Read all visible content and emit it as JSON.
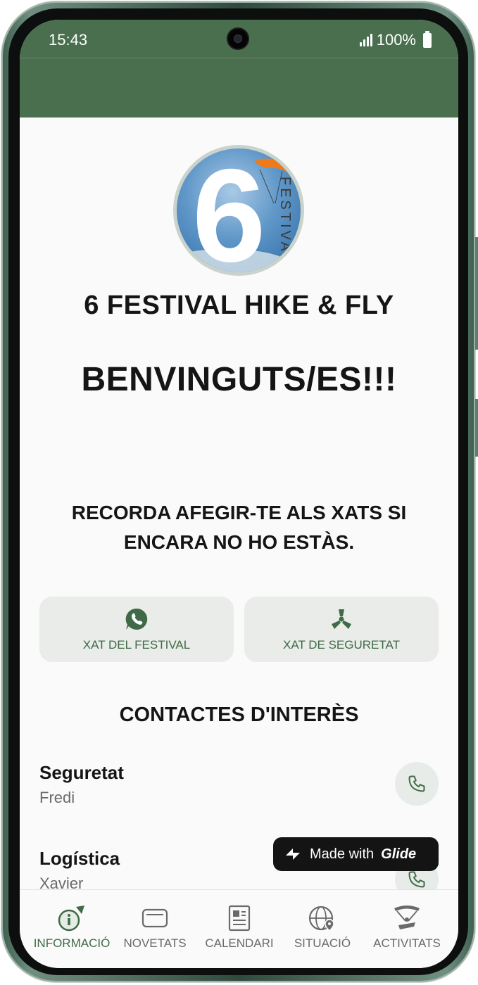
{
  "status": {
    "time": "15:43",
    "battery": "100%"
  },
  "app": {
    "title": "6 FESTIVAL HIKE & FLY",
    "welcome": "BENVINGUTS/ES!!!",
    "notice": "RECORDA AFEGIR-TE ALS XATS SI ENCARA NO HO ESTÀS.",
    "logo": {
      "digit": "6",
      "word": "FESTIVAL"
    }
  },
  "chats": [
    {
      "label": "XAT DEL FESTIVAL",
      "icon": "whatsapp-icon"
    },
    {
      "label": "XAT DE SEGURETAT",
      "icon": "radiation-icon"
    }
  ],
  "contacts": {
    "title": "CONTACTES D'INTERÈS",
    "items": [
      {
        "name": "Seguretat",
        "person": "Fredi",
        "icon": "phone-icon"
      },
      {
        "name": "Logística",
        "person": "Xavier",
        "icon": "phone-icon"
      }
    ]
  },
  "badge": {
    "prefix": "Made with",
    "brand": "Glide"
  },
  "tabs": [
    {
      "label": "INFORMACIÓ",
      "icon": "info-icon",
      "active": true
    },
    {
      "label": "NOVETATS",
      "icon": "card-icon",
      "active": false
    },
    {
      "label": "CALENDARI",
      "icon": "newspaper-icon",
      "active": false
    },
    {
      "label": "SITUACIÓ",
      "icon": "globe-pin-icon",
      "active": false
    },
    {
      "label": "ACTIVITATS",
      "icon": "paraglider-icon",
      "active": false
    }
  ],
  "colors": {
    "header": "#4a6f4e",
    "accent": "#3f6a47",
    "button_bg": "#e9ece8"
  }
}
